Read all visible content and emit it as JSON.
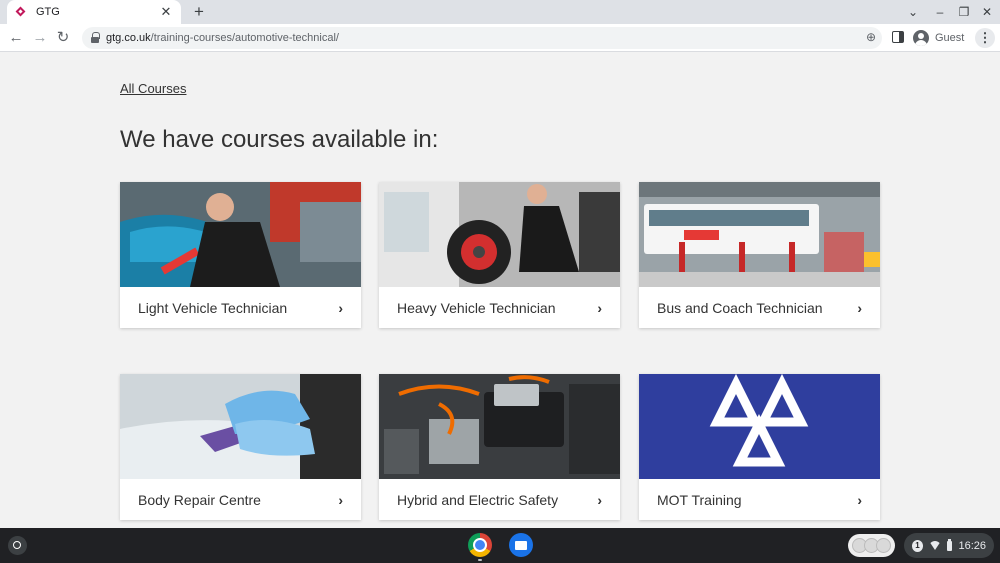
{
  "browser": {
    "tab_title": "GTG",
    "tab_close": "✕",
    "new_tab": "+",
    "url_host": "gtg.co.uk",
    "url_path": "/training-courses/automotive-technical/",
    "profile_label": "Guest",
    "icons": [
      "back-icon",
      "forward-icon",
      "reload-icon",
      "lock-icon",
      "zoom-icon",
      "side-panel-icon",
      "profile-avatar-icon",
      "menu-icon"
    ]
  },
  "page": {
    "back_link": "All Courses",
    "heading": "We have courses available in:",
    "cards": [
      {
        "label": "Light Vehicle Technician",
        "image": "technician-working-on-car-engine",
        "accent": "#1b7fa6"
      },
      {
        "label": "Heavy Vehicle Technician",
        "image": "mechanic-at-truck-wheel",
        "accent": "#d32f2f"
      },
      {
        "label": "Bus and Coach Technician",
        "image": "bus-on-lift-in-workshop",
        "accent": "#e53935"
      },
      {
        "label": "Body Repair Centre",
        "image": "hand-polishing-car-panel",
        "accent": "#6a4fa3"
      },
      {
        "label": "Hybrid and Electric Safety",
        "image": "electric-vehicle-engine-bay",
        "accent": "#ef6c00"
      },
      {
        "label": "MOT Training",
        "image": "mot-triple-triangle-logo",
        "accent": "#2f3e9e"
      }
    ],
    "chevron": "›"
  },
  "shelf": {
    "notification_count": "1",
    "time": "16:26"
  }
}
